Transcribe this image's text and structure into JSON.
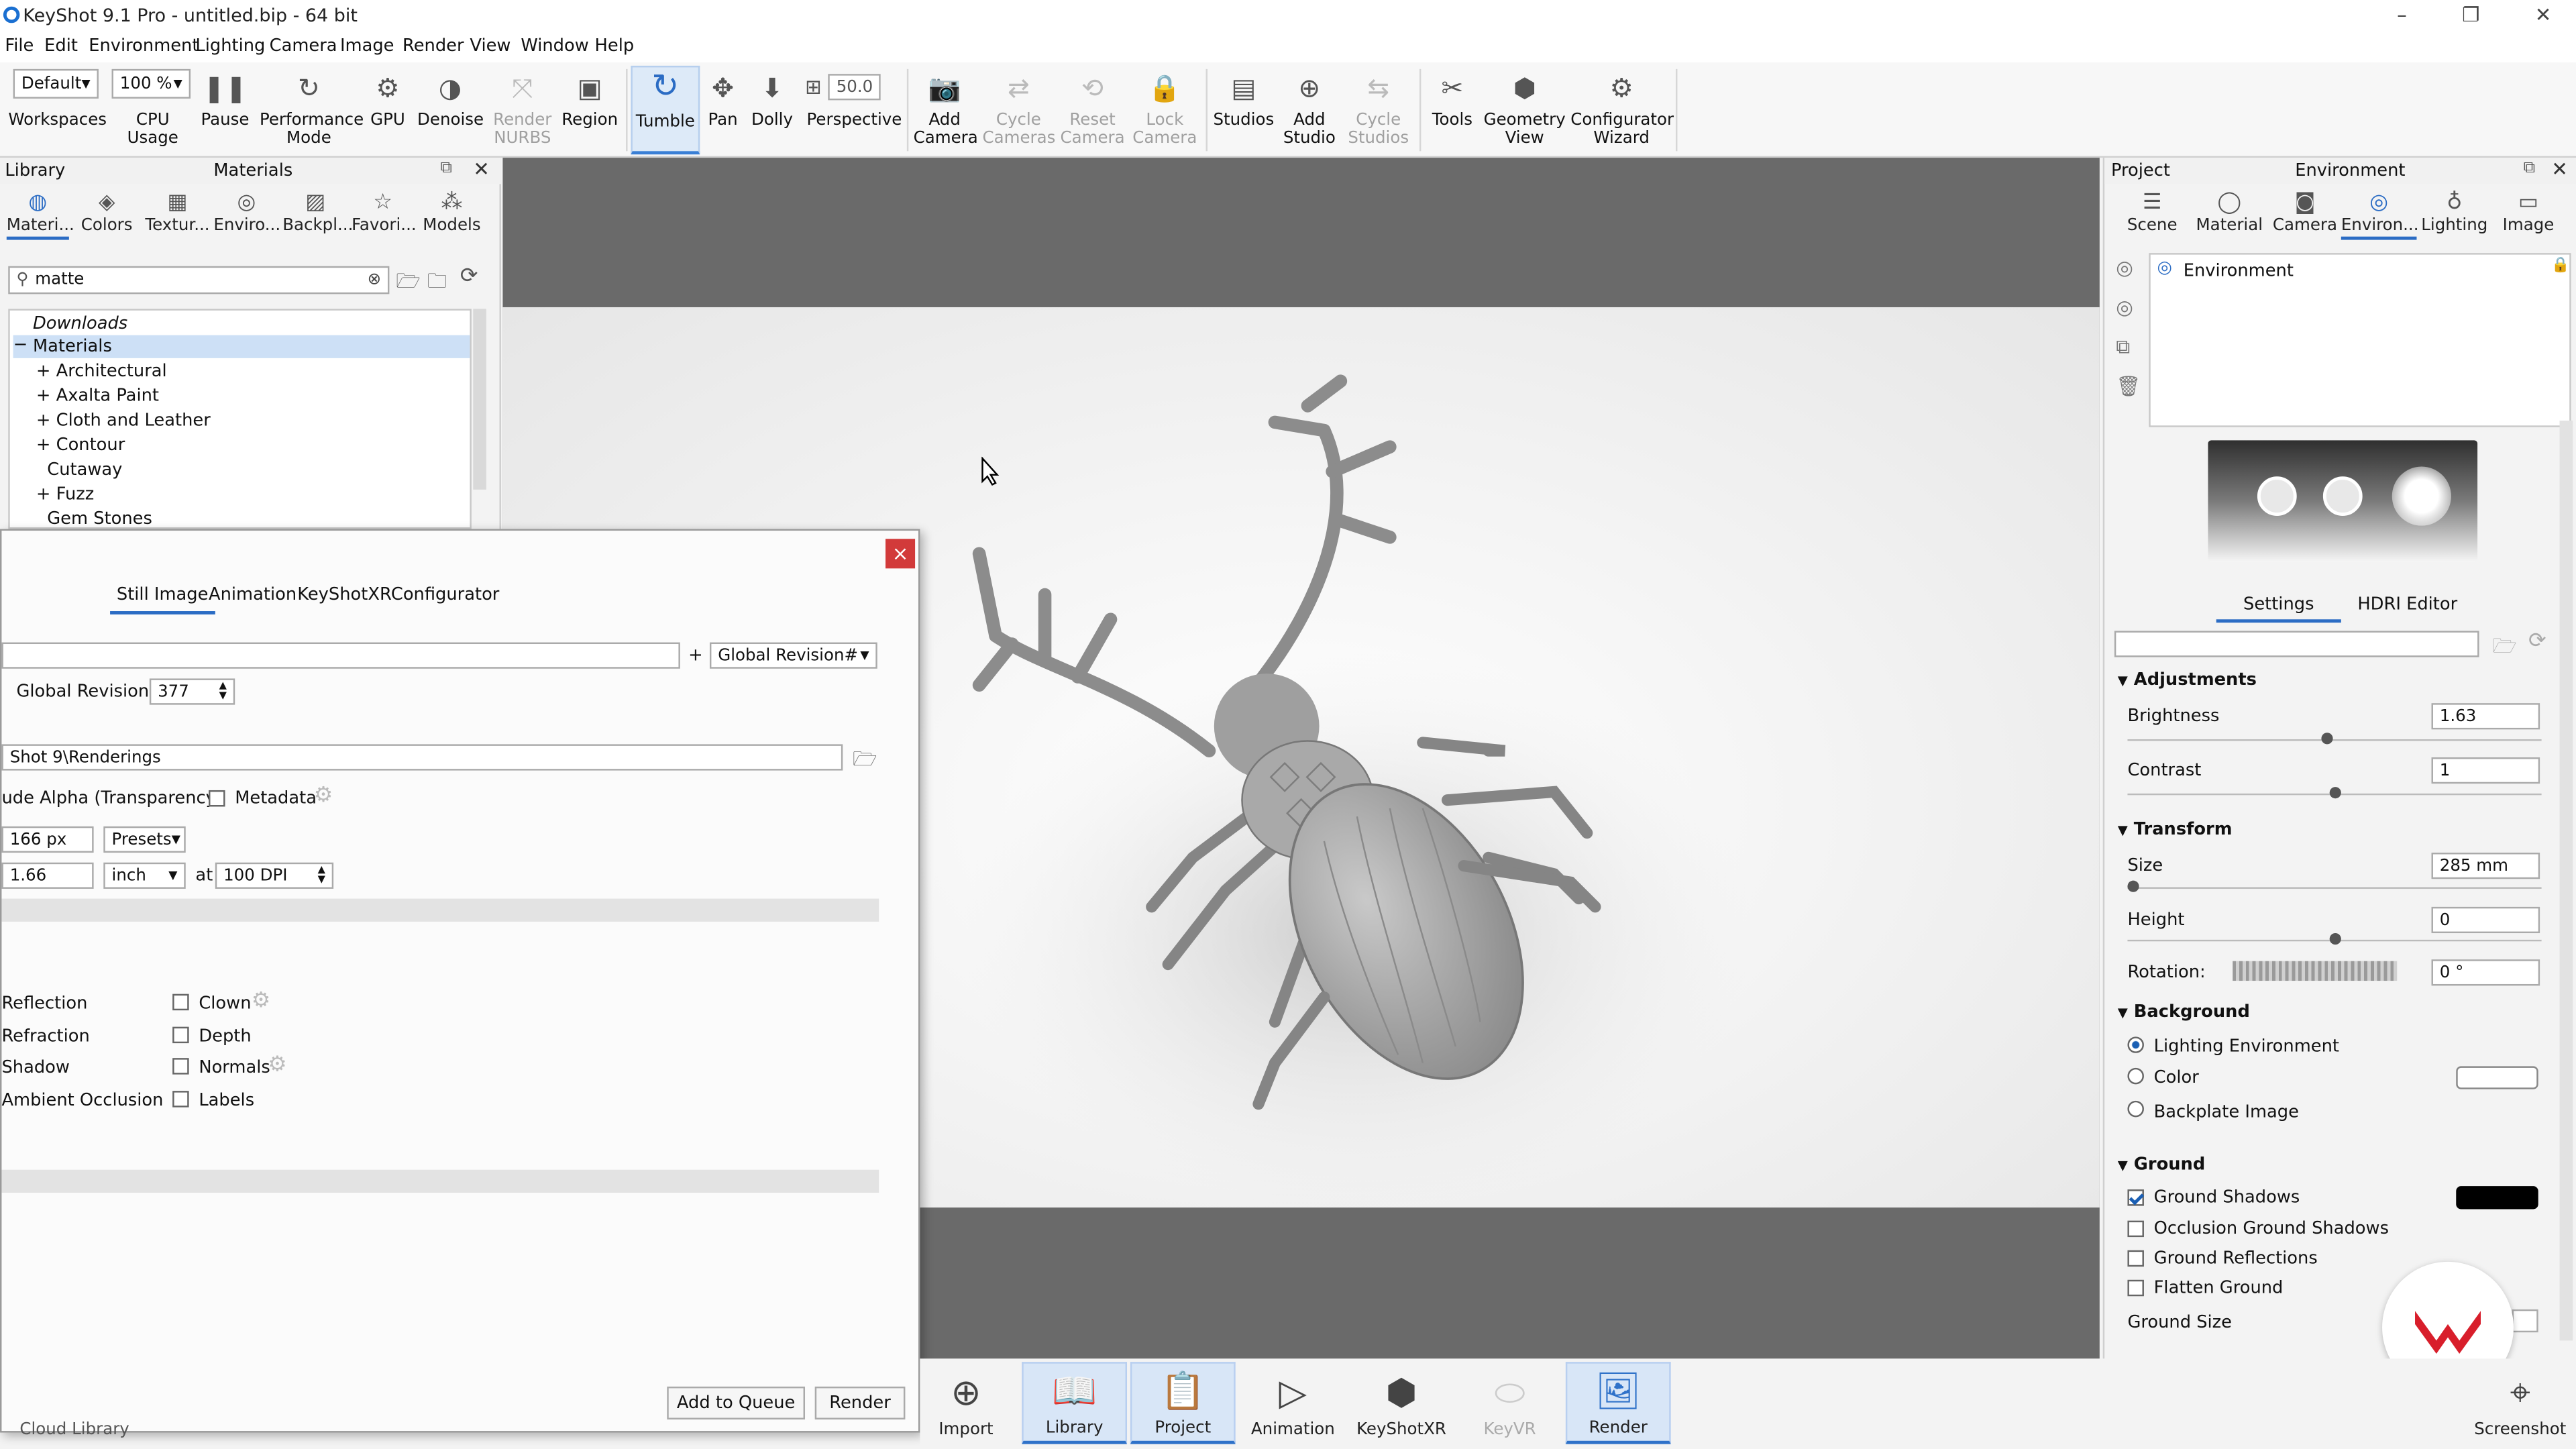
{
  "window": {
    "title": "KeyShot 9.1 Pro  - untitled.bip  - 64 bit"
  },
  "menu": [
    "File",
    "Edit",
    "Environment",
    "Lighting",
    "Camera",
    "Image",
    "Render",
    "View",
    "Window",
    "Help"
  ],
  "toolbar": {
    "workspace_value": "Default",
    "cpu_value": "100 %",
    "fov_value": "50.0",
    "workspaces": "Workspaces",
    "cpu_usage": "CPU Usage",
    "pause": "Pause",
    "performance": "Performance Mode",
    "gpu": "GPU",
    "denoise": "Denoise",
    "render_nurbs": "Render NURBS",
    "region": "Region",
    "tumble": "Tumble",
    "pan": "Pan",
    "dolly": "Dolly",
    "perspective": "Perspective",
    "add_camera": "Add Camera",
    "cycle_cameras": "Cycle Cameras",
    "reset_camera": "Reset Camera",
    "lock_camera": "Lock Camera",
    "studios": "Studios",
    "add_studio": "Add Studio",
    "cycle_studios": "Cycle Studios",
    "tools": "Tools",
    "geometry_view": "Geometry View",
    "configurator_wizard": "Configurator Wizard"
  },
  "library": {
    "panel_title": "Library",
    "section_title": "Materials",
    "tabs": [
      "Materi...",
      "Colors",
      "Textur...",
      "Enviro...",
      "Backpl...",
      "Favori...",
      "Models"
    ],
    "search_value": "matte",
    "tree": [
      "Downloads",
      "Materials",
      "Architectural",
      "Axalta Paint",
      "Cloth and Leather",
      "Contour",
      "Cutaway",
      "Fuzz",
      "Gem Stones"
    ],
    "cloud_library": "Cloud Library"
  },
  "dialog": {
    "tabs": [
      "Still Image",
      "Animation",
      "KeyShotXR",
      "Configurator"
    ],
    "plus": "+",
    "revision_dropdown": "Global Revision#",
    "global_revision_label": "Global Revision #",
    "global_revision_value": "377",
    "folder_value": "Shot 9\\Renderings",
    "alpha_label": "ude Alpha (Transparency)",
    "metadata_label": "Metadata",
    "width_value": "166 px",
    "presets_value": "Presets",
    "print_value": "1.66",
    "unit_value": "inch",
    "at_label": "at",
    "dpi_value": "100 DPI",
    "passes_left": [
      "Reflection",
      "Refraction",
      "Shadow",
      "Ambient Occlusion"
    ],
    "passes_right": [
      "Clown",
      "Depth",
      "Normals",
      "Labels"
    ],
    "add_to_queue": "Add to Queue",
    "render": "Render",
    "close": "×"
  },
  "project": {
    "panel_title": "Project",
    "section_title": "Environment",
    "tabs": [
      "Scene",
      "Material",
      "Camera",
      "Environ...",
      "Lighting",
      "Image"
    ],
    "env_item": "Environment",
    "subtabs": [
      "Settings",
      "HDRI Editor"
    ],
    "adjustments": "Adjustments",
    "brightness_label": "Brightness",
    "brightness_value": "1.63",
    "brightness_level": 0.48,
    "contrast_label": "Contrast",
    "contrast_value": "1",
    "contrast_level": 0.5,
    "transform": "Transform",
    "size_label": "Size",
    "size_value": "285 mm",
    "size_level": 0.0,
    "height_label": "Height",
    "height_value": "0",
    "height_level": 0.5,
    "rotation_label": "Rotation:",
    "rotation_value": "0 °",
    "background": "Background",
    "bg_options": [
      "Lighting Environment",
      "Color",
      "Backplate Image"
    ],
    "bg_selected": 0,
    "ground": "Ground",
    "ground_options": [
      "Ground Shadows",
      "Occlusion Ground Shadows",
      "Ground Reflections",
      "Flatten Ground"
    ],
    "ground_checked": [
      true,
      false,
      false,
      false
    ],
    "ground_size_label": "Ground Size"
  },
  "ribbon": [
    "Import",
    "Library",
    "Project",
    "Animation",
    "KeyShotXR",
    "KeyVR",
    "Render",
    "Screenshot"
  ],
  "colors": {
    "accent": "#2b6cc4",
    "close_button": "#d23a3a",
    "logo": "#d81e2b"
  }
}
